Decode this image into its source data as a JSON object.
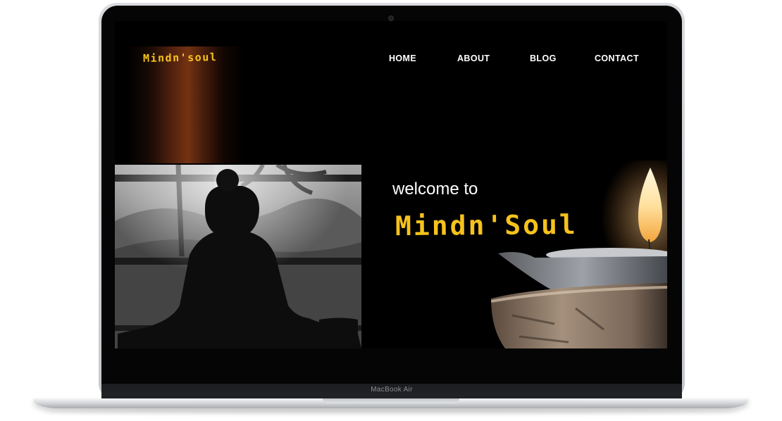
{
  "device": {
    "model_label": "MacBook Air"
  },
  "site": {
    "logo_text": "Mindn'soul",
    "nav": {
      "home": "HOME",
      "about": "ABOUT",
      "blog": "BLOG",
      "contact": "CONTACT"
    },
    "hero": {
      "welcome_text": "welcome to",
      "brand_text": "Mindn'Soul"
    }
  },
  "colors": {
    "brand_yellow": "#f6c21c",
    "background": "#000000",
    "nav_text": "#ffffff"
  }
}
